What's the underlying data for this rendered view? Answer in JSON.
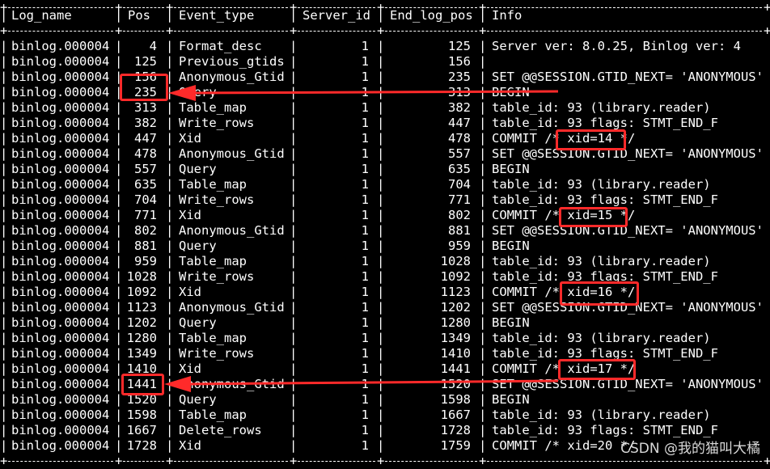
{
  "headers": [
    "Log_name",
    "Pos",
    "Event_type",
    "Server_id",
    "End_log_pos",
    "Info"
  ],
  "rows": [
    [
      "binlog.000004",
      "4",
      "Format_desc",
      "1",
      "125",
      "Server ver: 8.0.25, Binlog ver: 4"
    ],
    [
      "binlog.000004",
      "125",
      "Previous_gtids",
      "1",
      "156",
      ""
    ],
    [
      "binlog.000004",
      "156",
      "Anonymous_Gtid",
      "1",
      "235",
      "SET @@SESSION.GTID_NEXT= 'ANONYMOUS'"
    ],
    [
      "binlog.000004",
      "235",
      "Query",
      "1",
      "313",
      "BEGIN"
    ],
    [
      "binlog.000004",
      "313",
      "Table_map",
      "1",
      "382",
      "table_id: 93 (library.reader)"
    ],
    [
      "binlog.000004",
      "382",
      "Write_rows",
      "1",
      "447",
      "table_id: 93 flags: STMT_END_F"
    ],
    [
      "binlog.000004",
      "447",
      "Xid",
      "1",
      "478",
      "COMMIT /* xid=14 */"
    ],
    [
      "binlog.000004",
      "478",
      "Anonymous_Gtid",
      "1",
      "557",
      "SET @@SESSION.GTID_NEXT= 'ANONYMOUS'"
    ],
    [
      "binlog.000004",
      "557",
      "Query",
      "1",
      "635",
      "BEGIN"
    ],
    [
      "binlog.000004",
      "635",
      "Table_map",
      "1",
      "704",
      "table_id: 93 (library.reader)"
    ],
    [
      "binlog.000004",
      "704",
      "Write_rows",
      "1",
      "771",
      "table_id: 93 flags: STMT_END_F"
    ],
    [
      "binlog.000004",
      "771",
      "Xid",
      "1",
      "802",
      "COMMIT /* xid=15 */"
    ],
    [
      "binlog.000004",
      "802",
      "Anonymous_Gtid",
      "1",
      "881",
      "SET @@SESSION.GTID_NEXT= 'ANONYMOUS'"
    ],
    [
      "binlog.000004",
      "881",
      "Query",
      "1",
      "959",
      "BEGIN"
    ],
    [
      "binlog.000004",
      "959",
      "Table_map",
      "1",
      "1028",
      "table_id: 93 (library.reader)"
    ],
    [
      "binlog.000004",
      "1028",
      "Write_rows",
      "1",
      "1092",
      "table_id: 93 flags: STMT_END_F"
    ],
    [
      "binlog.000004",
      "1092",
      "Xid",
      "1",
      "1123",
      "COMMIT /* xid=16 */"
    ],
    [
      "binlog.000004",
      "1123",
      "Anonymous_Gtid",
      "1",
      "1202",
      "SET @@SESSION.GTID_NEXT= 'ANONYMOUS'"
    ],
    [
      "binlog.000004",
      "1202",
      "Query",
      "1",
      "1280",
      "BEGIN"
    ],
    [
      "binlog.000004",
      "1280",
      "Table_map",
      "1",
      "1349",
      "table_id: 93 (library.reader)"
    ],
    [
      "binlog.000004",
      "1349",
      "Write_rows",
      "1",
      "1410",
      "table_id: 93 flags: STMT_END_F"
    ],
    [
      "binlog.000004",
      "1410",
      "Xid",
      "1",
      "1441",
      "COMMIT /* xid=17 */"
    ],
    [
      "binlog.000004",
      "1441",
      "Anonymous_Gtid",
      "1",
      "1520",
      "SET @@SESSION.GTID_NEXT= 'ANONYMOUS'"
    ],
    [
      "binlog.000004",
      "1520",
      "Query",
      "1",
      "1598",
      "BEGIN"
    ],
    [
      "binlog.000004",
      "1598",
      "Table_map",
      "1",
      "1667",
      "table_id: 93 (library.reader)"
    ],
    [
      "binlog.000004",
      "1667",
      "Delete_rows",
      "1",
      "1728",
      "table_id: 93 flags: STMT_END_F"
    ],
    [
      "binlog.000004",
      "1728",
      "Xid",
      "1",
      "1759",
      "COMMIT /* xid=20 */"
    ]
  ],
  "watermark": "CSDN @我的猫叫大橘",
  "colors": {
    "background": "#000000",
    "text": "#ffffff",
    "annotation": "#ff2a2a"
  }
}
